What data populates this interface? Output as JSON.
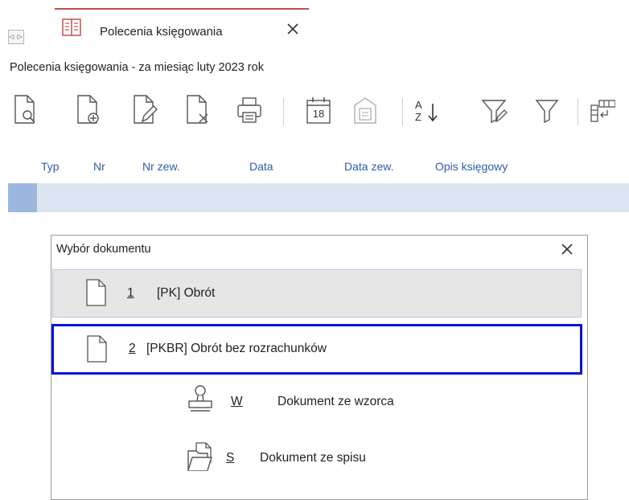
{
  "tab": {
    "nav_arrows": "◁ ▷",
    "title": "Polecenia księgowania"
  },
  "window": {
    "subtitle": "Polecenia księgowania - za miesiąc luty 2023 rok"
  },
  "toolbar": {
    "items": [
      {
        "icon": "document-preview-icon"
      },
      {
        "icon": "document-add-icon"
      },
      {
        "icon": "document-edit-icon"
      },
      {
        "icon": "document-delete-icon"
      },
      {
        "icon": "printer-icon"
      },
      {
        "icon": "calendar-icon",
        "calendar_day": "18"
      },
      {
        "icon": "archive-icon"
      },
      {
        "icon": "sort-az-icon",
        "sort_top": "A",
        "sort_bottom": "Z"
      },
      {
        "icon": "filter-edit-icon"
      },
      {
        "icon": "filter-icon"
      },
      {
        "icon": "columns-icon"
      }
    ]
  },
  "grid": {
    "columns": [
      "Typ",
      "Nr",
      "Nr zew.",
      "Data",
      "Data zew.",
      "Opis księgowy"
    ]
  },
  "popup": {
    "title": "Wybór dokumentu",
    "options": [
      {
        "key": "1",
        "label": "[PK] Obrót",
        "icon": "document-icon"
      },
      {
        "key": "2",
        "label": "[PKBR] Obrót bez rozrachunków",
        "icon": "document-icon"
      },
      {
        "key": "W",
        "label": "Dokument ze wzorca",
        "icon": "stamp-icon"
      },
      {
        "key": "S",
        "label": "Dokument ze spisu",
        "icon": "folder-documents-icon"
      }
    ]
  },
  "colors": {
    "tab_accent": "#c0504d",
    "column_header_text": "#2f5da7",
    "grid_row": "#dce6f2",
    "grid_row_selector": "#9cb7dd",
    "focus_border": "#0b10e0",
    "hover_row": "#e6e6e6"
  }
}
